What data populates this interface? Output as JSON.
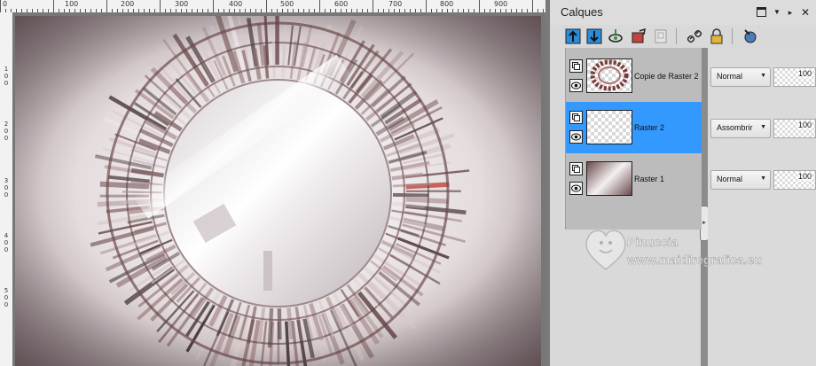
{
  "ruler": {
    "top_labels": [
      "0",
      "100",
      "200",
      "300",
      "400",
      "500",
      "600",
      "700",
      "800",
      "900"
    ],
    "left_labels": [
      "1\n0\n0",
      "2\n0\n0",
      "3\n0\n0",
      "4\n0\n0",
      "5\n0\n0"
    ]
  },
  "palette": {
    "title": "Calques",
    "toolbar_icons": [
      "new-raster-layer-icon",
      "new-vector-layer-icon",
      "new-mask-layer-icon",
      "new-adjustment-layer-icon",
      "promote-layer-icon",
      "link-layer-icon",
      "lock-layer-icon",
      "layer-properties-icon"
    ]
  },
  "layers": [
    {
      "name": "Copie de Raster 2",
      "blend": "Normal",
      "opacity": "100",
      "selected": false
    },
    {
      "name": "Raster 2",
      "blend": "Assombrir",
      "opacity": "100",
      "selected": true
    },
    {
      "name": "Raster 1",
      "blend": "Normal",
      "opacity": "100",
      "selected": false
    }
  ],
  "watermark": {
    "author": "Pinuccia",
    "site": "www.maidiregrafica.eu"
  },
  "colors": {
    "selection": "#3399ff",
    "accent_red": "#c0453e",
    "mauve": "#6b4a4c"
  }
}
